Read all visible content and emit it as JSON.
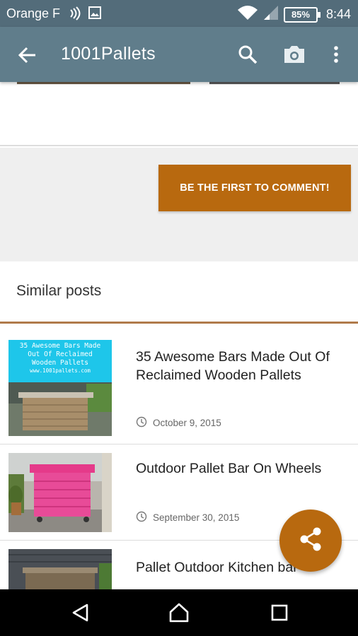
{
  "status_bar": {
    "carrier": "Orange F",
    "battery": "85%",
    "time": "8:44",
    "icons": [
      "nfc-icon",
      "image-icon",
      "wifi-icon",
      "signal-icon",
      "battery-icon"
    ]
  },
  "app_bar": {
    "title": "1001Pallets",
    "actions": [
      "back-arrow-icon",
      "search-icon",
      "camera-icon",
      "more-vert-icon"
    ]
  },
  "comments": {
    "button_label": "BE THE FIRST TO COMMENT!"
  },
  "similar": {
    "heading": "Similar posts",
    "posts": [
      {
        "title": "35 Awesome Bars Made Out Of Reclaimed Wooden Pallets",
        "date": "October 9, 2015",
        "thumb_caption_lines": [
          "35 Awesome Bars Made",
          "Out Of Reclaimed",
          "Wooden Pallets",
          "www.1001pallets.com"
        ]
      },
      {
        "title": "Outdoor Pallet Bar On Wheels",
        "date": "September 30, 2015"
      },
      {
        "title": "Pallet Outdoor Kitchen bar",
        "date": ""
      }
    ]
  },
  "colors": {
    "status_bar": "#536c7a",
    "app_bar": "#607d8b",
    "accent": "#b8690f",
    "divider_accent": "#b07a4a"
  },
  "fab": {
    "icon": "share-icon"
  },
  "nav_bar": {
    "icons": [
      "nav-back-icon",
      "nav-home-icon",
      "nav-recents-icon"
    ]
  }
}
